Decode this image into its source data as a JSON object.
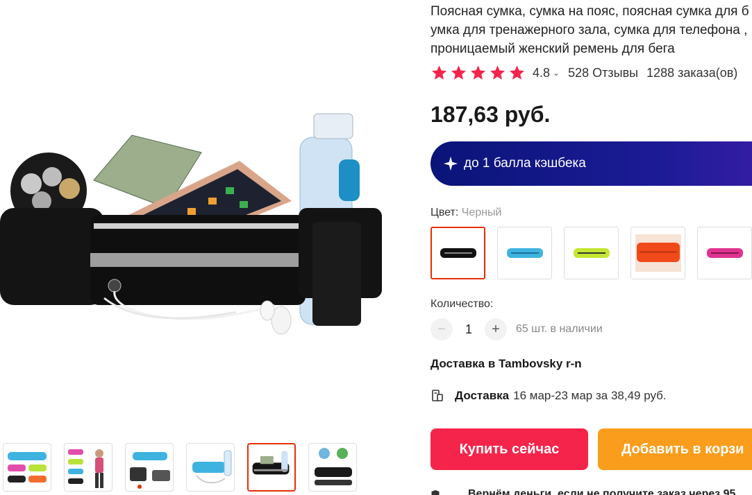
{
  "product": {
    "title_lines": [
      "Поясная сумка, сумка на пояс, поясная сумка для б",
      "умка для тренажерного зала, сумка для телефона ,",
      "проницаемый женский ремень для бега"
    ],
    "rating": "4.8",
    "reviews": "528 Отзывы",
    "orders": "1288 заказа(ов)",
    "price": "187,63 руб.",
    "cashback": "до 1 балла кэшбека"
  },
  "color": {
    "label": "Цвет: ",
    "selected": "Черный",
    "options": [
      "black",
      "sky-blue",
      "lime-green",
      "orange",
      "pink"
    ]
  },
  "quantity": {
    "label": "Количество:",
    "minus": "−",
    "value": "1",
    "plus": "+",
    "stock": "65 шт. в наличии"
  },
  "shipping": {
    "to": "Доставка в Tambovsky r-n",
    "label": "Доставка",
    "details": "16 мар-23 мар за 38,49 руб."
  },
  "actions": {
    "buy": "Купить сейчас",
    "cart": "Добавить в корзи"
  },
  "guarantee": "Вернём деньги, если не получите заказ через 95",
  "colors": {
    "accent": "#f5244b",
    "cart": "#fa9d1c",
    "cashback": "#1c1b96",
    "star": "#f5244b",
    "selected_border": "#e62e04"
  },
  "icons": [
    "star-icon",
    "chevron-down-icon",
    "cashback-icon",
    "delivery-icon",
    "shield-icon"
  ]
}
